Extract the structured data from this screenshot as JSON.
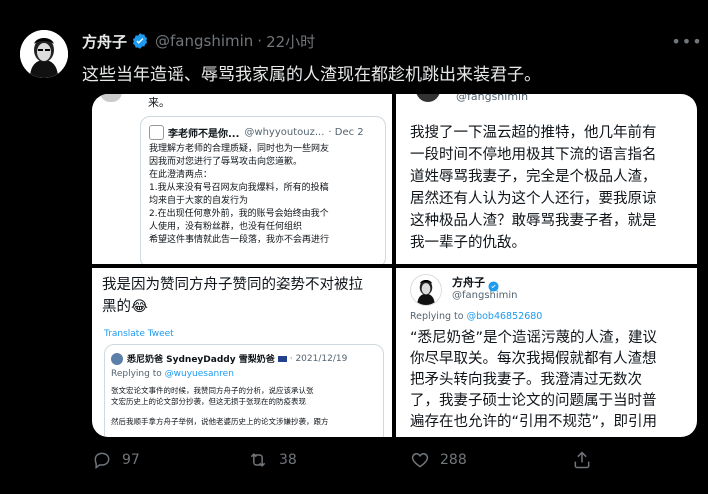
{
  "author": {
    "name": "方舟子",
    "handle": "@fangshimin",
    "time": "22小时"
  },
  "tweet": {
    "text": "这些当年造谣、辱骂我家属的人渣现在都趁机跳出来装君子。"
  },
  "media": {
    "panel1": {
      "top_fragment": "来。",
      "quoted_name": "李老师不是你...",
      "quoted_handle": "@whyyoutouz...",
      "quoted_date": "· Dec 2",
      "lines": [
        "我理解方老师的合理质疑，同时也为一些网友",
        "因我而对您进行了辱骂攻击向您道歉。",
        "在此澄清两点：",
        "1.我从来没有号召网友向我爆料，所有的投稿",
        "均来自于大家的自发行为",
        "2.在出现任何意外前，我的账号会始终由我个",
        "人使用，没有粉丝群，也没有任何组织",
        "希望这件事情就此告一段落，我亦不会再进行"
      ]
    },
    "panel2": {
      "handle": "@fangshimin",
      "lines": [
        "我搜了一下温云超的推特，他几年前有",
        "一段时间不停地用极其下流的语言指名",
        "道姓辱骂我妻子，完全是个极品人渣，",
        "居然还有人认为这个人还行，要我原谅",
        "这种极品人渣？敢辱骂我妻子者，就是",
        "我一辈子的仇敌。"
      ]
    },
    "panel3": {
      "lines": [
        "我是因为赞同方舟子赞同的姿势不对被拉",
        "黑的😂"
      ],
      "translate": "Translate Tweet",
      "quoted_name": "悉尼奶爸 SydneyDaddy 雪梨奶爸",
      "quoted_date": "· 2021/12/19",
      "replying_label": "Replying to",
      "replying_to": "@wuyuesanren",
      "quoted_lines": [
        "张文宏论文事件的时候，我赞同方舟子的分析，说应该承认张",
        "文宏历史上的论文部分抄袭，但这无损于张现在的防疫表现",
        "",
        "然后我顺手拿方舟子举例，说他老婆历史上的论文涉嫌抄袭，跟方"
      ]
    },
    "panel4": {
      "name": "方舟子",
      "handle": "@fangshimin",
      "replying_label": "Replying to",
      "replying_to": "@bob46852680",
      "lines": [
        "“悉尼奶爸”是个造谣污蔑的人渣，建议",
        "你尽早取关。每次我揭假就都有人渣想",
        "把矛头转向我妻子。我澄清过无数次",
        "了，我妻子硕士论文的问题属于当时普",
        "遍存在也允许的“引用不规范”，即引用"
      ]
    }
  },
  "actions": {
    "reply_count": "97",
    "retweet_count": "38",
    "like_count": "288"
  },
  "colors": {
    "background": "#000000",
    "text": "#e7e9ea",
    "muted": "#71767b",
    "verified": "#1d9bf0",
    "link": "#1d9bf0"
  }
}
